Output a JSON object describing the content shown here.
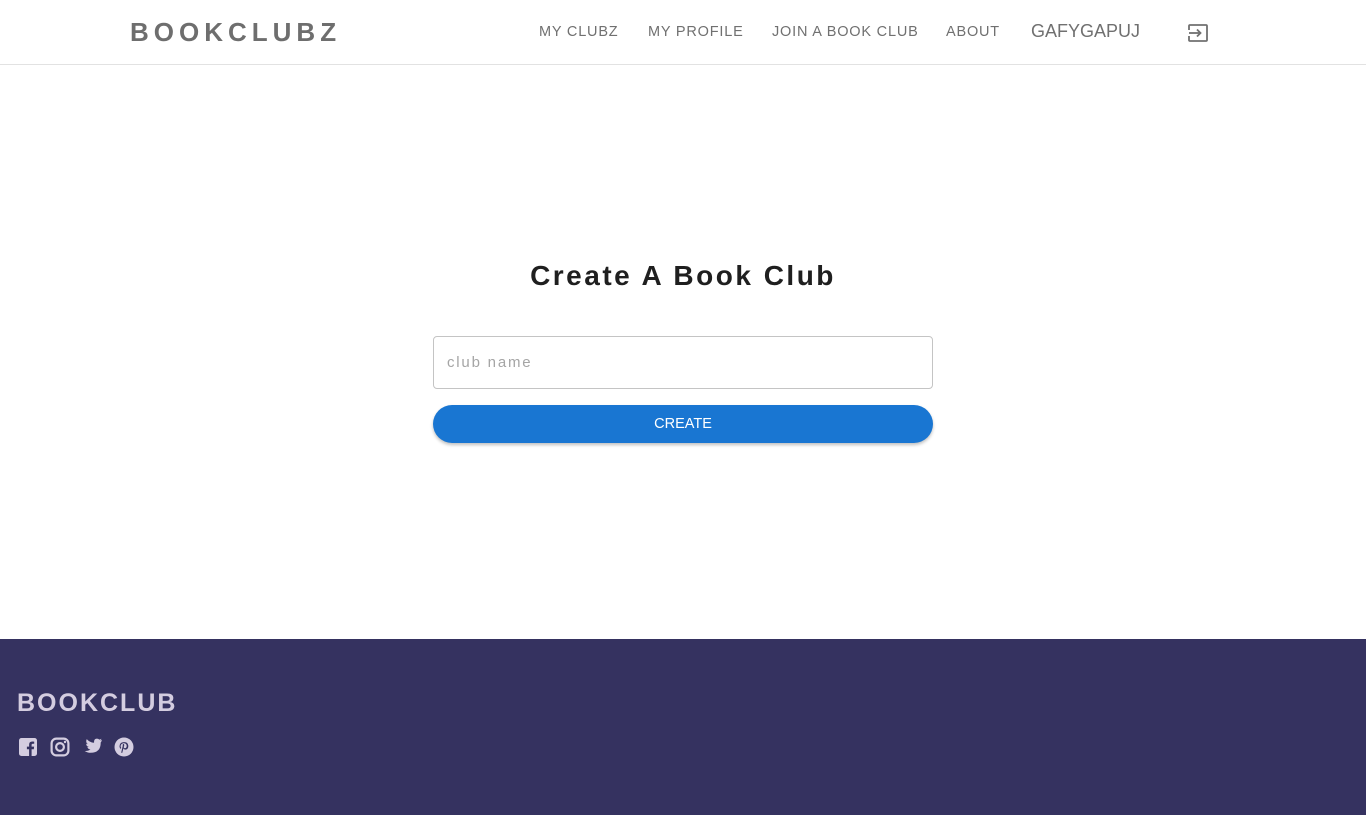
{
  "header": {
    "brand": "BOOKCLUBZ",
    "nav": {
      "my_clubz": "MY CLUBZ",
      "my_profile": "MY PROFILE",
      "join_club": "JOIN A BOOK CLUB",
      "about": "ABOUT"
    },
    "username": "GAFYGAPUJ",
    "logout_icon": "logout-icon"
  },
  "main": {
    "title": "Create A Book Club",
    "club_name_placeholder": "club name",
    "club_name_value": "",
    "create_label": "CREATE"
  },
  "footer": {
    "brand": "BOOKCLUB",
    "social_icons": [
      "facebook-icon",
      "instagram-icon",
      "twitter-icon",
      "pinterest-icon"
    ]
  },
  "colors": {
    "primary": "#1976d2",
    "footer_bg": "#353260",
    "footer_text": "#d4cde0",
    "nav_text": "#707070"
  }
}
